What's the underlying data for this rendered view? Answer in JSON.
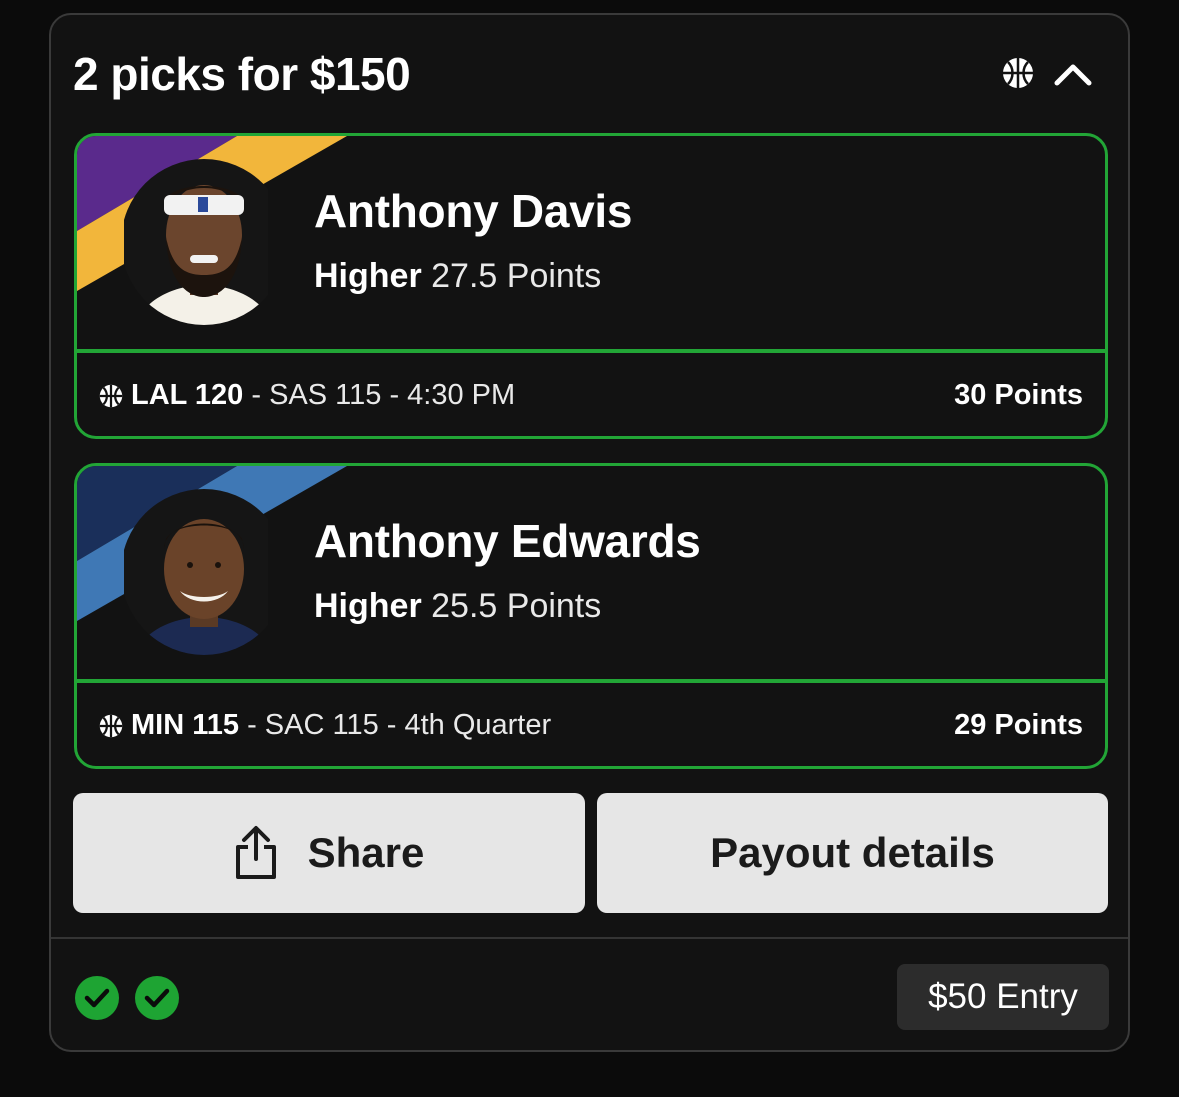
{
  "header": {
    "title": "2 picks for $150",
    "sport_icon": "basketball-icon",
    "toggle_icon": "chevron-up-icon"
  },
  "picks": [
    {
      "player": "Anthony Davis",
      "direction": "Higher",
      "line": "27.5 Points",
      "team_colors": [
        "#5a2a8c",
        "#f2b63b"
      ],
      "game": {
        "team": "LAL 120",
        "rest": "- SAS 115 - 4:30 PM"
      },
      "result": "30 Points"
    },
    {
      "player": "Anthony Edwards",
      "direction": "Higher",
      "line": "25.5 Points",
      "team_colors": [
        "#1a2f5a",
        "#3f78b5"
      ],
      "game": {
        "team": "MIN 115",
        "rest": "- SAC 115 - 4th Quarter"
      },
      "result": "29 Points"
    }
  ],
  "actions": {
    "share_label": "Share",
    "payout_label": "Payout details"
  },
  "footer": {
    "status": [
      "check",
      "check"
    ],
    "entry_label": "$50 Entry"
  },
  "colors": {
    "accent_green": "#22a536",
    "background": "#121212",
    "button_bg": "#e6e6e6"
  }
}
